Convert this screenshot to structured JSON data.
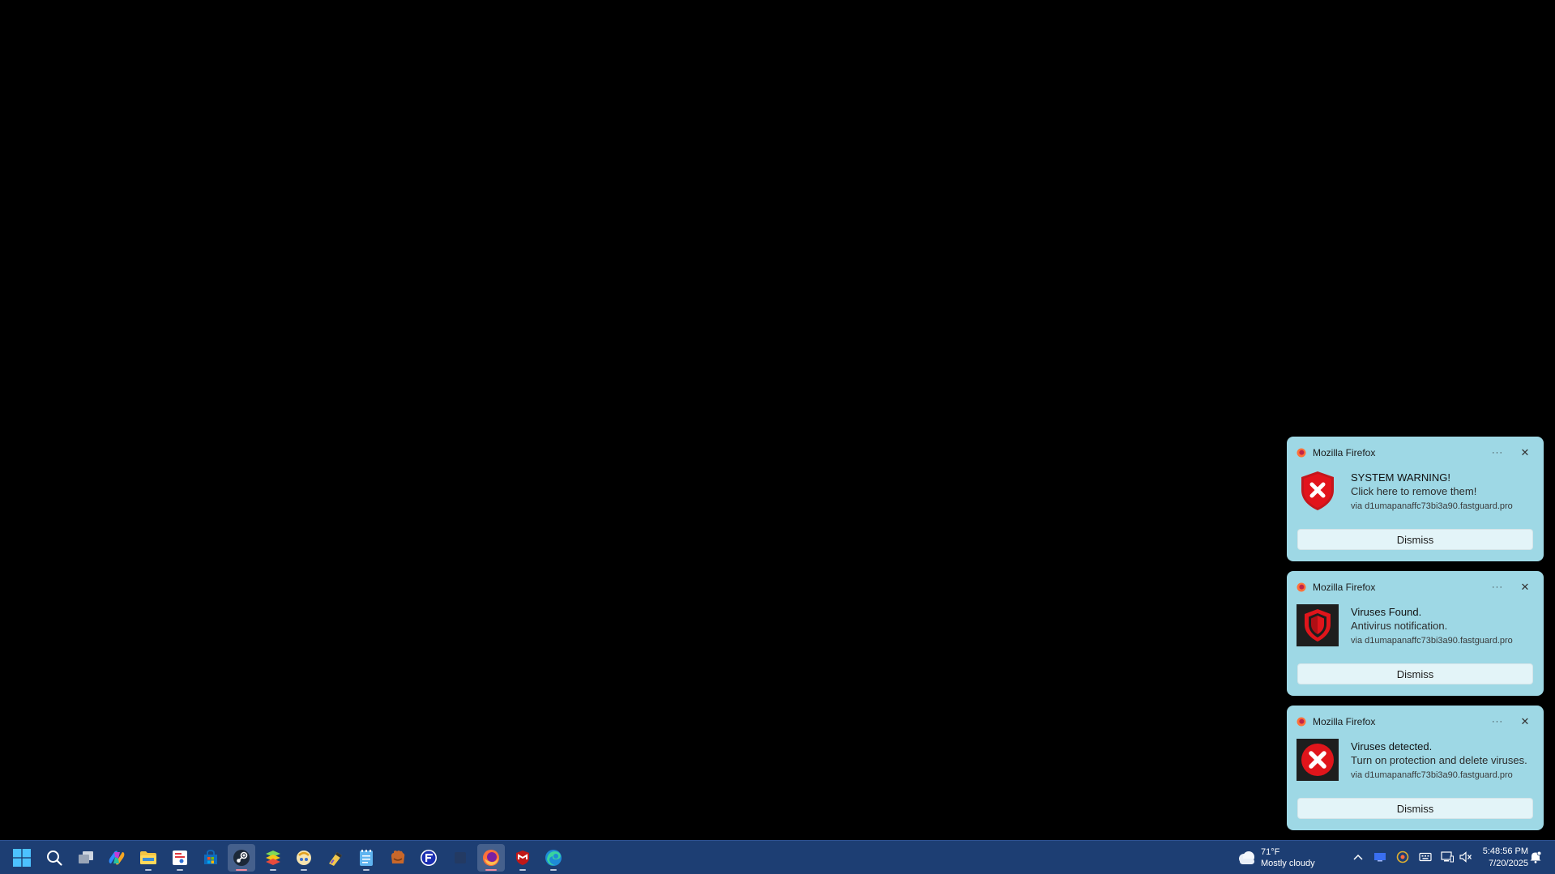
{
  "notifications": [
    {
      "app_name": "Mozilla Firefox",
      "more_label": "···",
      "close_label": "✕",
      "title": "SYSTEM WARNING!",
      "body": "Click here to remove them!",
      "via": "via d1umapanaffc73bi3a90.fastguard.pro",
      "icon": "red-shield-x-icon",
      "dismiss_label": "Dismiss"
    },
    {
      "app_name": "Mozilla Firefox",
      "more_label": "···",
      "close_label": "✕",
      "title": "Viruses Found.",
      "body": "Antivirus notification.",
      "via": "via d1umapanaffc73bi3a90.fastguard.pro",
      "icon": "red-shield-dark-icon",
      "dismiss_label": "Dismiss"
    },
    {
      "app_name": "Mozilla Firefox",
      "more_label": "···",
      "close_label": "✕",
      "title": "Viruses detected.",
      "body": "Turn on protection and delete viruses.",
      "via": "via d1umapanaffc73bi3a90.fastguard.pro",
      "icon": "red-circle-x-icon",
      "dismiss_label": "Dismiss"
    }
  ],
  "taskbar": {
    "apps": [
      {
        "name": "start-icon",
        "active": false,
        "running": false
      },
      {
        "name": "search-icon",
        "active": false,
        "running": false
      },
      {
        "name": "task-view-icon",
        "active": false,
        "running": false
      },
      {
        "name": "copilot-icon",
        "active": false,
        "running": false
      },
      {
        "name": "file-explorer-icon",
        "active": false,
        "running": true
      },
      {
        "name": "snipping-tool-icon",
        "active": false,
        "running": true
      },
      {
        "name": "microsoft-store-icon",
        "active": false,
        "running": false
      },
      {
        "name": "steam-icon",
        "active": true,
        "running": true
      },
      {
        "name": "bluestacks-icon",
        "active": false,
        "running": true
      },
      {
        "name": "emulator-icon",
        "active": false,
        "running": true
      },
      {
        "name": "winrar-icon",
        "active": false,
        "running": false
      },
      {
        "name": "notepad-icon",
        "active": false,
        "running": true
      },
      {
        "name": "baseball-glove-icon",
        "active": false,
        "running": false
      },
      {
        "name": "fastpass-icon",
        "active": false,
        "running": false
      },
      {
        "name": "blank-app-icon",
        "active": false,
        "running": false
      },
      {
        "name": "firefox-icon",
        "active": true,
        "running": true
      },
      {
        "name": "mcafee-icon",
        "active": false,
        "running": true
      },
      {
        "name": "edge-icon",
        "active": false,
        "running": true
      }
    ],
    "weather": {
      "temp": "71°F",
      "condition": "Mostly cloudy"
    },
    "clock": {
      "time": "5:48:56 PM",
      "date": "7/20/2025"
    },
    "tray_icons": [
      "chevron-up-icon",
      "display-icon",
      "audio-device-icon",
      "keyboard-icon",
      "network-icon",
      "muted-speaker-icon",
      "notification-bell-icon"
    ],
    "colors": {
      "taskbar_bg": "#1d3e73",
      "toast_bg": "#9ed8e5",
      "alert_red": "#e2141c"
    }
  }
}
